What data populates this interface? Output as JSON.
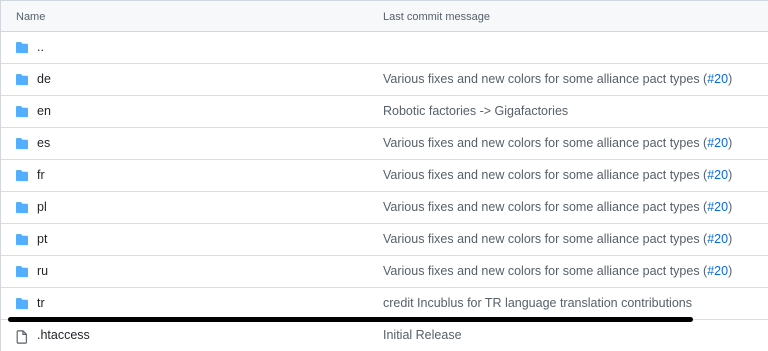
{
  "header": {
    "name_label": "Name",
    "message_label": "Last commit message"
  },
  "rows": [
    {
      "name": "..",
      "type": "folder",
      "msg": "",
      "pr": ""
    },
    {
      "name": "de",
      "type": "folder",
      "msg": "Various fixes and new colors for some alliance pact types (",
      "pr": "#20",
      "close": ")"
    },
    {
      "name": "en",
      "type": "folder",
      "msg": "Robotic factories -> Gigafactories",
      "pr": "",
      "close": ""
    },
    {
      "name": "es",
      "type": "folder",
      "msg": "Various fixes and new colors for some alliance pact types (",
      "pr": "#20",
      "close": ")"
    },
    {
      "name": "fr",
      "type": "folder",
      "msg": "Various fixes and new colors for some alliance pact types (",
      "pr": "#20",
      "close": ")"
    },
    {
      "name": "pl",
      "type": "folder",
      "msg": "Various fixes and new colors for some alliance pact types (",
      "pr": "#20",
      "close": ")"
    },
    {
      "name": "pt",
      "type": "folder",
      "msg": "Various fixes and new colors for some alliance pact types (",
      "pr": "#20",
      "close": ")"
    },
    {
      "name": "ru",
      "type": "folder",
      "msg": "Various fixes and new colors for some alliance pact types (",
      "pr": "#20",
      "close": ")"
    },
    {
      "name": "tr",
      "type": "folder",
      "msg": "credit Incublus for TR language translation contributions",
      "pr": "",
      "close": ""
    },
    {
      "name": ".htaccess",
      "type": "file",
      "msg": "Initial Release",
      "pr": "",
      "close": ""
    }
  ],
  "colors": {
    "folder": "#54aeff",
    "file_icon": "#57606a",
    "link": "#0969da"
  }
}
